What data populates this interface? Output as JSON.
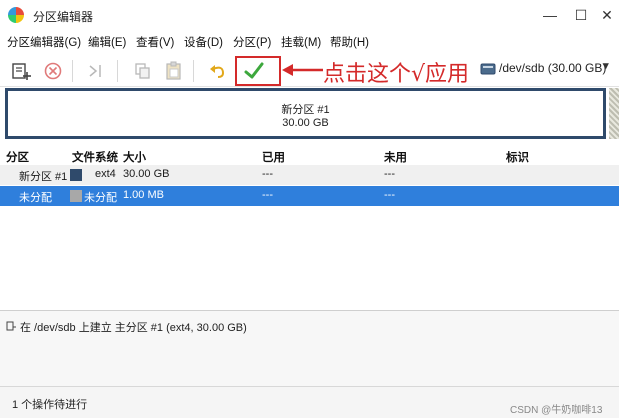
{
  "window": {
    "title": "分区编辑器",
    "min": "—",
    "max": "☐",
    "close": "✕"
  },
  "menu": [
    "分区编辑器(G)",
    "编辑(E)",
    "查看(V)",
    "设备(D)",
    "分区(P)",
    "挂载(M)",
    "帮助(H)"
  ],
  "toolbar": {
    "annotation": "点击这个√应用",
    "device": "/dev/sdb (30.00 GB)"
  },
  "map": {
    "name": "新分区 #1",
    "size": "30.00 GB"
  },
  "table": {
    "headers": [
      "分区",
      "文件系统",
      "大小",
      "已用",
      "未用",
      "标识"
    ],
    "rows": [
      {
        "partition": "新分区 #1",
        "fs": "ext4",
        "fs_color": "#2f4a6b",
        "size": "30.00 GB",
        "used": "---",
        "unused": "---",
        "flags": ""
      },
      {
        "partition": "未分配",
        "fs": "未分配",
        "fs_color": "#a8a8a8",
        "size": "1.00 MB",
        "used": "---",
        "unused": "---",
        "flags": ""
      }
    ]
  },
  "operations": {
    "items": [
      "在 /dev/sdb 上建立 主分区 #1 (ext4, 30.00 GB)"
    ]
  },
  "status": {
    "text": "1 个操作待进行"
  },
  "watermark": "CSDN @牛奶咖啡13",
  "colors": {
    "accent": "#2f7fdc",
    "annotation": "#d42a2a",
    "ext4": "#2f4a6b"
  }
}
